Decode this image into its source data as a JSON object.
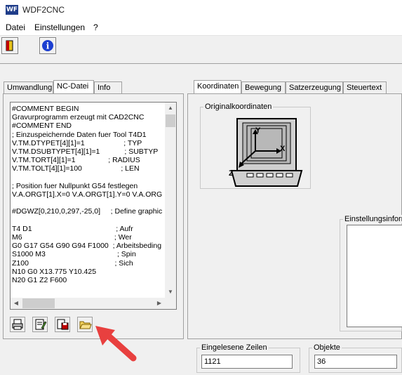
{
  "window": {
    "title": "WDF2CNC",
    "icon_text": "WF"
  },
  "menu": {
    "items": [
      "Datei",
      "Einstellungen",
      "?"
    ]
  },
  "left_tabs": [
    "Umwandlung",
    "NC-Datei",
    "Info"
  ],
  "right_tabs": [
    "Koordinaten",
    "Bewegung",
    "Satzerzeugung",
    "Steuertext"
  ],
  "code_lines": [
    "#COMMENT BEGIN",
    "Gravurprogramm erzeugt mit CAD2CNC",
    "#COMMENT END",
    "; Einzuspeichernde Daten fuer Tool T4D1",
    "V.TM.DTYPET[4][1]=1                   ; TYP",
    "V.TM.DSUBTYPET[4][1]=1            ; SUBTYP",
    "V.TM.TORT[4][1]=1                ; RADIUS",
    "V.TM.TOLT[4][1]=100                   ; LEN",
    "",
    "; Position fuer Nullpunkt G54 festlegen",
    "V.A.ORGT[1].X=0 V.A.ORGT[1].Y=0 V.A.ORG",
    "",
    "#DGWZ[0,210,0,297,-25,0]     ; Define graphic",
    "",
    "T4 D1                                         ; Aufr",
    "M6                                             ; Wer",
    "G0 G17 G54 G90 G94 F1000  ; Arbeitsbeding",
    "S1000 M3                                   ; Spin",
    "Z100                                          ; Sich",
    "N10 G0 X13.775 Y10.425",
    "N20 G1 Z2 F600"
  ],
  "original_coords": {
    "label": "Originalkoordinaten",
    "axis_x": "X",
    "axis_y": "Y",
    "axis_z": "Z"
  },
  "settings_info": {
    "label": "Einstellungsinforr"
  },
  "read_lines": {
    "label": "Eingelesene Zeilen",
    "value": "1121"
  },
  "objects": {
    "label": "Objekte",
    "value": "36"
  },
  "colors": {
    "arrow": "#e8403f",
    "toolbar_exit": "#e8c21a",
    "info_blue": "#1c3fd1"
  }
}
